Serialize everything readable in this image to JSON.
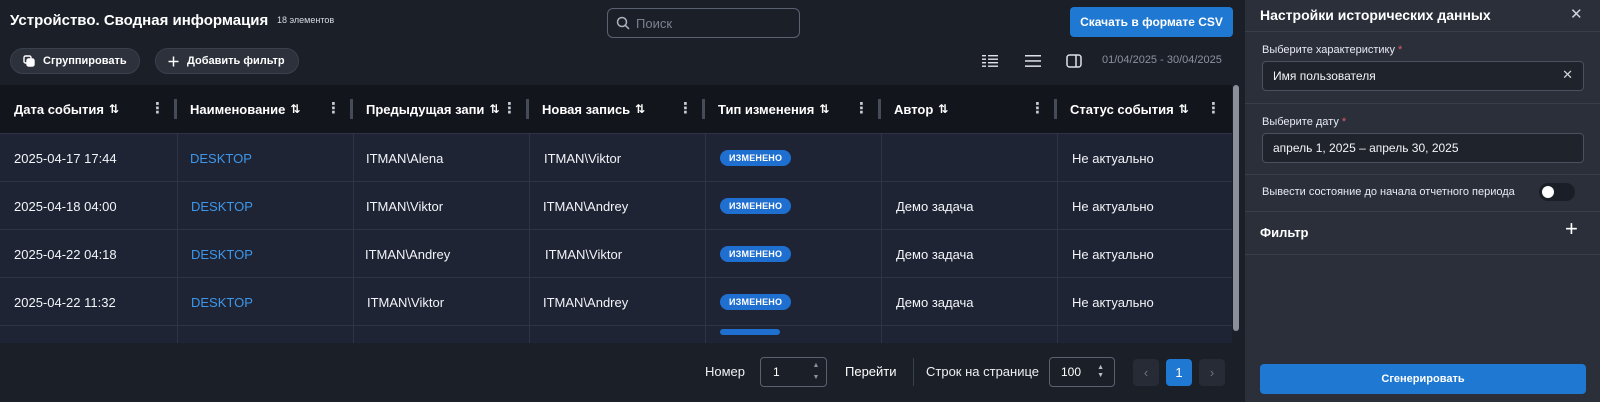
{
  "header": {
    "title": "Устройство. Сводная информация",
    "count": "18 элементов",
    "search_placeholder": "Поиск",
    "csv_button": "Скачать в формате CSV"
  },
  "toolbar": {
    "group_button": "Сгруппировать",
    "add_filter_button": "Добавить фильтр",
    "date_range": "01/04/2025 - 30/04/2025"
  },
  "table": {
    "columns": [
      {
        "label": "Дата события"
      },
      {
        "label": "Наименование"
      },
      {
        "label": "Предыдущая запи"
      },
      {
        "label": "Новая запись"
      },
      {
        "label": "Тип изменения"
      },
      {
        "label": "Автор"
      },
      {
        "label": "Статус события"
      }
    ],
    "rows": [
      {
        "date": "2025-04-17 17:44",
        "name": "DESKTOP",
        "prev": "ITMAN\\Alena",
        "new": "ITMAN\\Viktor",
        "type": "ИЗМЕНЕНО",
        "author": "",
        "status": "Не актуально"
      },
      {
        "date": "2025-04-18 04:00",
        "name": "DESKTOP",
        "prev": "ITMAN\\Viktor",
        "new": "ITMAN\\Andrey",
        "type": "ИЗМЕНЕНО",
        "author": "Демо задача",
        "status": "Не актуально"
      },
      {
        "date": "2025-04-22 04:18",
        "name": "DESKTOP",
        "prev": "ITMAN\\Andrey",
        "new": "ITMAN\\Viktor",
        "type": "ИЗМЕНЕНО",
        "author": "Демо задача",
        "status": "Не актуально"
      },
      {
        "date": "2025-04-22 11:32",
        "name": "DESKTOP",
        "prev": "ITMAN\\Viktor",
        "new": "ITMAN\\Andrey",
        "type": "ИЗМЕНЕНО",
        "author": "Демо задача",
        "status": "Не актуально"
      }
    ]
  },
  "pagination": {
    "page_label": "Номер",
    "page_value": "1",
    "go_label": "Перейти",
    "rows_label": "Строк на странице",
    "rows_value": "100",
    "current_page": "1",
    "prev_icon": "chevron-left-icon",
    "next_icon": "chevron-right-icon"
  },
  "panel": {
    "title": "Настройки исторических данных",
    "characteristic_label": "Выберите характеристику",
    "characteristic_value": "Имя пользователя",
    "date_label": "Выберите дату",
    "date_value": "апрель 1, 2025 – апрель 30, 2025",
    "toggle_label": "Вывести состояние до начала отчетного периода",
    "toggle_on": false,
    "filter_label": "Фильтр",
    "generate_button": "Сгенерировать"
  },
  "colors": {
    "accent": "#1f78d1",
    "link": "#3d97ea",
    "required": "#e05a66",
    "row_bg": "#1e2434",
    "header_bg": "#12151b",
    "panel_bg": "#2a2f3a"
  }
}
